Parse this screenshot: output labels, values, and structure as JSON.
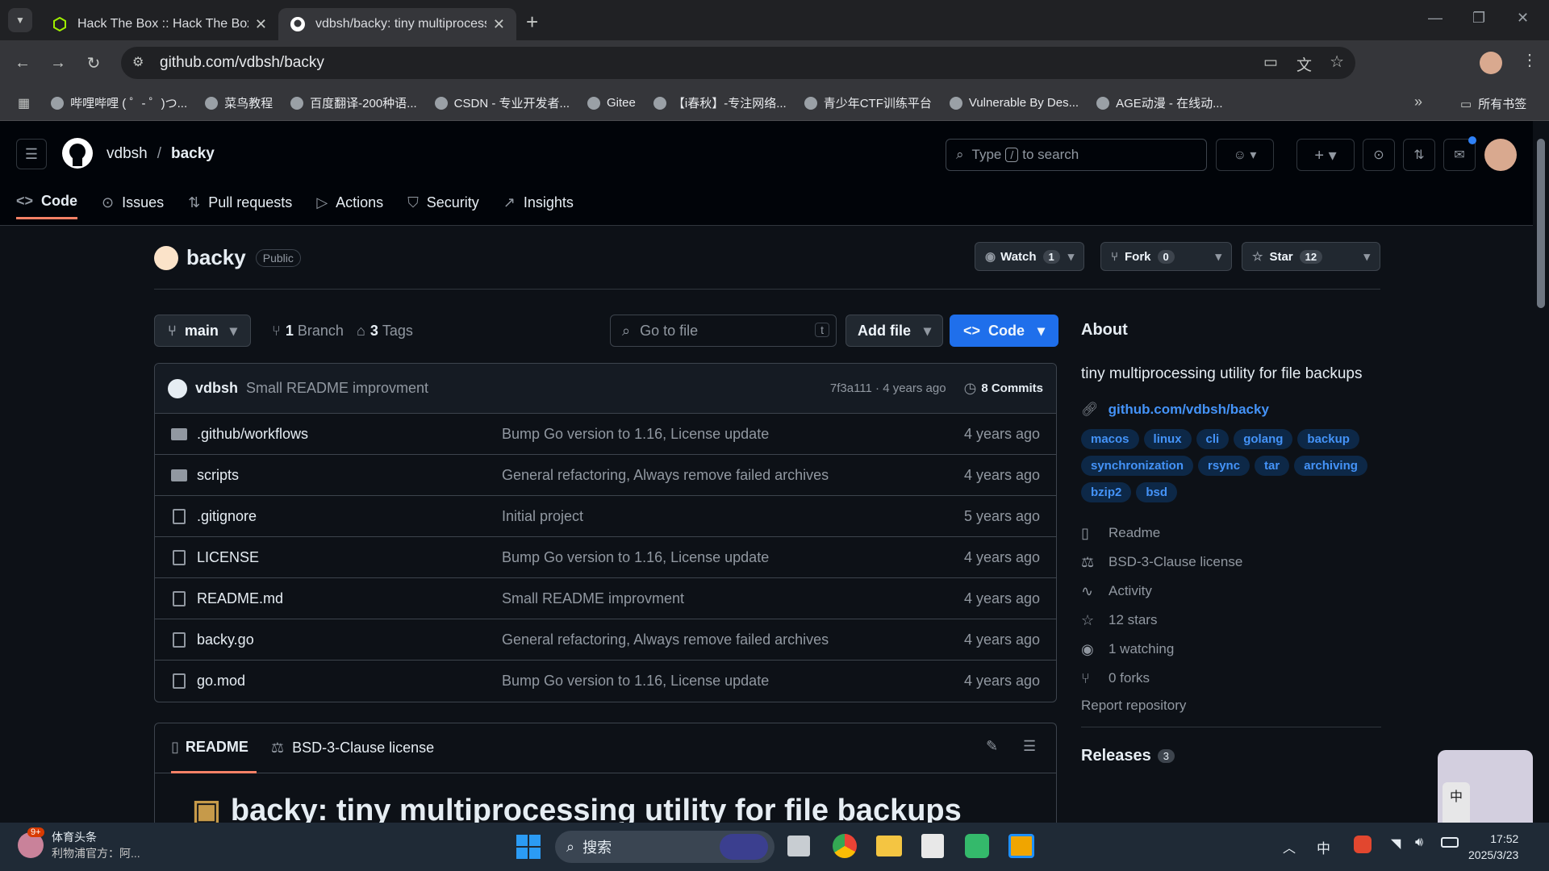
{
  "browser": {
    "tabs": [
      {
        "title": "Hack The Box :: Hack The Box",
        "active": false
      },
      {
        "title": "vdbsh/backy: tiny multiprocessing",
        "active": true
      }
    ],
    "url": "github.com/vdbsh/backy",
    "bookmarks": [
      "哔哩哔哩 ( ゜- ゜)つ...",
      "菜鸟教程",
      "百度翻译-200种语...",
      "CSDN - 专业开发者...",
      "Gitee",
      "【i春秋】-专注网络...",
      "青少年CTF训练平台",
      "Vulnerable By Des...",
      "AGE动漫 - 在线动..."
    ],
    "all_bookmarks": "所有书签"
  },
  "header": {
    "owner": "vdbsh",
    "repo": "backy",
    "search_prefix": "Type",
    "search_key": "/",
    "search_suffix": "to search",
    "tabs": [
      {
        "label": "Code",
        "icon": "code-icon"
      },
      {
        "label": "Issues",
        "icon": "issue-icon"
      },
      {
        "label": "Pull requests",
        "icon": "pull-request-icon"
      },
      {
        "label": "Actions",
        "icon": "play-icon"
      },
      {
        "label": "Security",
        "icon": "shield-icon"
      },
      {
        "label": "Insights",
        "icon": "graph-icon"
      }
    ]
  },
  "repo": {
    "name": "backy",
    "visibility": "Public",
    "watch": {
      "label": "Watch",
      "count": "1"
    },
    "fork": {
      "label": "Fork",
      "count": "0"
    },
    "star": {
      "label": "Star",
      "count": "12"
    },
    "branch": "main",
    "branches_num": "1",
    "branches_label": "Branch",
    "tags_num": "3",
    "tags_label": "Tags",
    "goto_placeholder": "Go to file",
    "goto_key": "t",
    "add_file": "Add file",
    "code": "Code",
    "commit": {
      "author": "vdbsh",
      "message": "Small README improvment",
      "sha_time": "7f3a111 · 4 years ago",
      "commits": "8 Commits"
    },
    "files": [
      {
        "name": ".github/workflows",
        "type": "folder",
        "message": "Bump Go version to 1.16, License update",
        "age": "4 years ago"
      },
      {
        "name": "scripts",
        "type": "folder",
        "message": "General refactoring, Always remove failed archives",
        "age": "4 years ago"
      },
      {
        "name": ".gitignore",
        "type": "file",
        "message": "Initial project",
        "age": "5 years ago"
      },
      {
        "name": "LICENSE",
        "type": "file",
        "message": "Bump Go version to 1.16, License update",
        "age": "4 years ago"
      },
      {
        "name": "README.md",
        "type": "file",
        "message": "Small README improvment",
        "age": "4 years ago"
      },
      {
        "name": "backy.go",
        "type": "file",
        "message": "General refactoring, Always remove failed archives",
        "age": "4 years ago"
      },
      {
        "name": "go.mod",
        "type": "file",
        "message": "Bump Go version to 1.16, License update",
        "age": "4 years ago"
      }
    ],
    "readme_tabs": [
      "README",
      "BSD-3-Clause license"
    ],
    "readme_title": "backy: tiny multiprocessing utility for file backups"
  },
  "about": {
    "heading": "About",
    "description": "tiny multiprocessing utility for file backups",
    "link": "github.com/vdbsh/backy",
    "topics": [
      "macos",
      "linux",
      "cli",
      "golang",
      "backup",
      "synchronization",
      "rsync",
      "tar",
      "archiving",
      "bzip2",
      "bsd"
    ],
    "items": [
      {
        "label": "Readme",
        "icon": "book-icon"
      },
      {
        "label": "BSD-3-Clause license",
        "icon": "law-icon"
      },
      {
        "label": "Activity",
        "icon": "pulse-icon"
      },
      {
        "label": "12 stars",
        "icon": "star-icon"
      },
      {
        "label": "1 watching",
        "icon": "eye-icon"
      },
      {
        "label": "0 forks",
        "icon": "fork-icon"
      }
    ],
    "report": "Report repository",
    "releases": "Releases",
    "releases_count": "3"
  },
  "taskbar": {
    "news_title": "体育头条",
    "news_sub": "利物浦官方：阿...",
    "news_badge": "9+",
    "search": "搜索",
    "ime": "中",
    "time": "17:52",
    "date": "2025/3/23"
  },
  "colors": {
    "accent": "#1f6feb",
    "tab_underline": "#f78166",
    "link": "#4493f8"
  }
}
